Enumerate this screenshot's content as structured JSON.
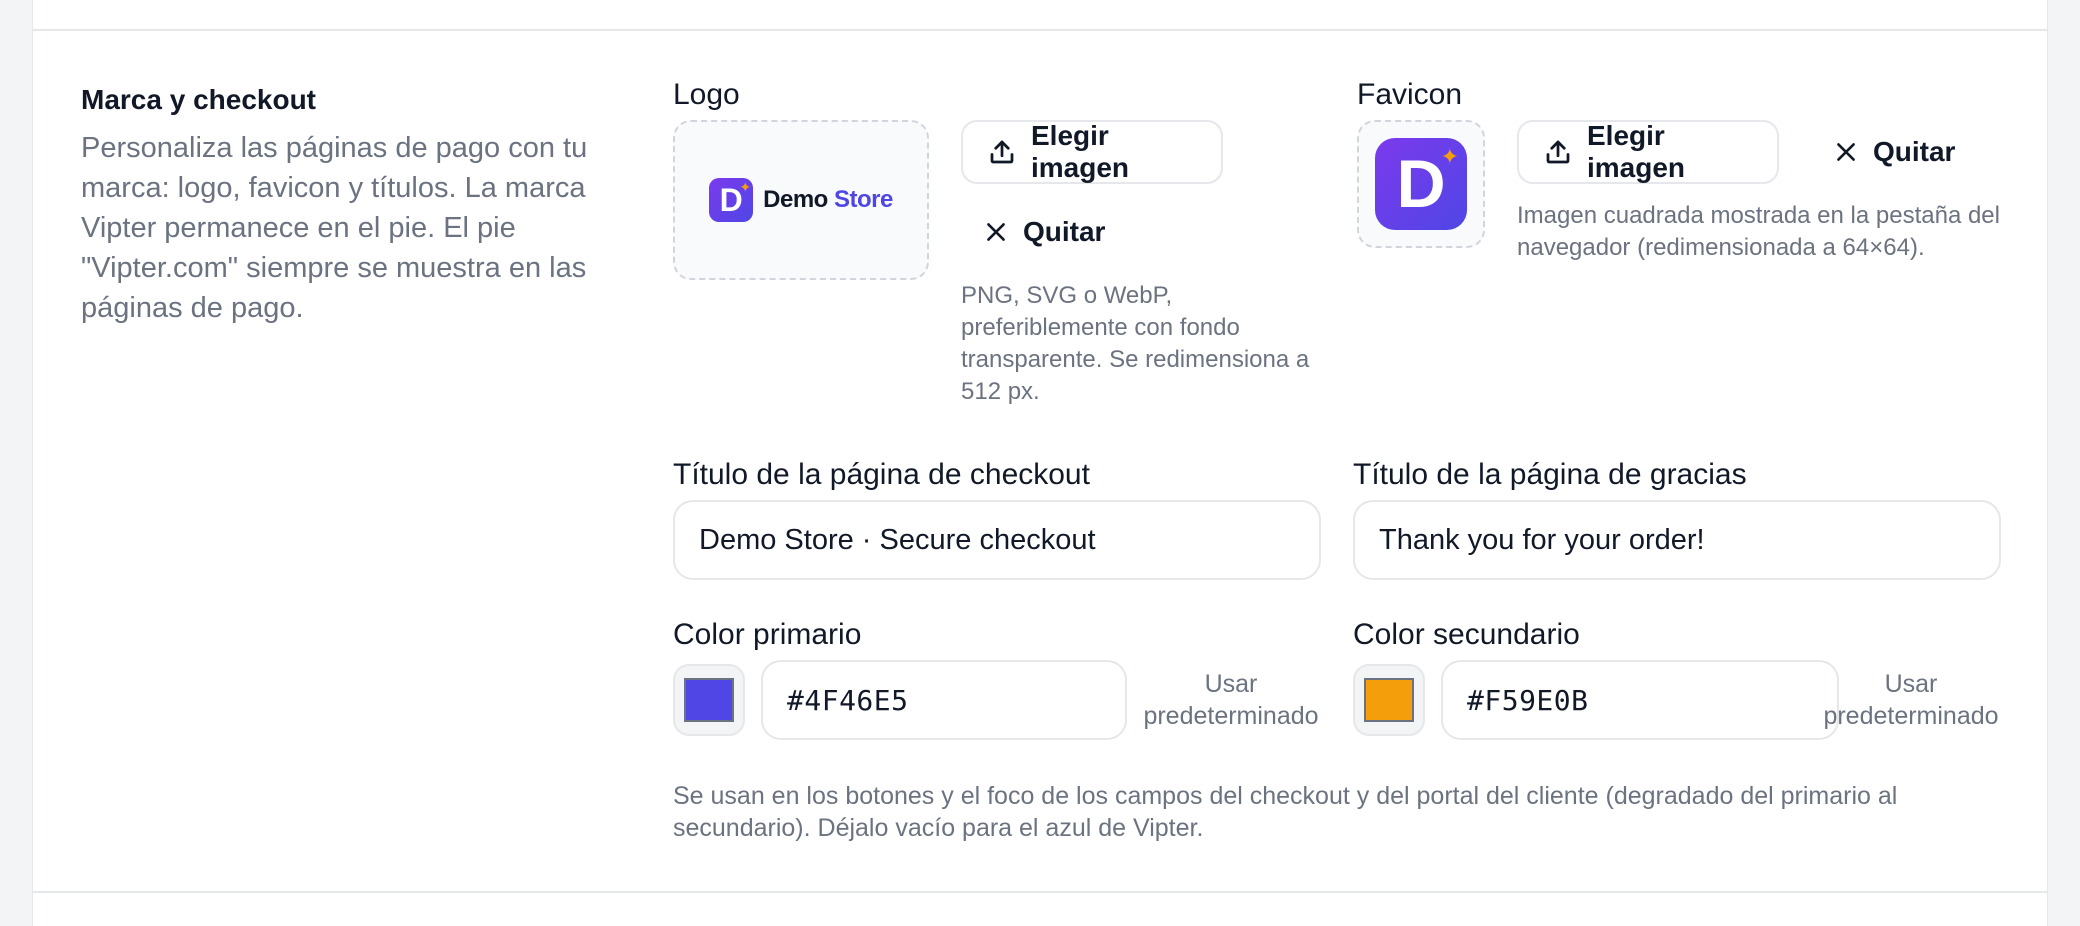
{
  "section": {
    "title": "Marca y checkout",
    "description": "Personaliza las páginas de pago con tu marca: logo, favicon y títulos. La marca Vipter permanece en el pie. El pie \"Vipter.com\" siempre se muestra en las páginas de pago."
  },
  "logo": {
    "label": "Logo",
    "preview_brand": "Demo",
    "preview_brand_accent": "Store",
    "choose_label": "Elegir imagen",
    "remove_label": "Quitar",
    "help": "PNG, SVG o WebP, preferiblemente con fondo transparente. Se redimensiona a 512 px."
  },
  "favicon": {
    "label": "Favicon",
    "choose_label": "Elegir imagen",
    "remove_label": "Quitar",
    "help": "Imagen cuadrada mostrada en la pestaña del navegador (redimensionada a 64×64)."
  },
  "checkout_title": {
    "label": "Título de la página de checkout",
    "value": "Demo Store · Secure checkout"
  },
  "thanks_title": {
    "label": "Título de la página de gracias",
    "value": "Thank you for your order!"
  },
  "primary_color": {
    "label": "Color primario",
    "value": "#4F46E5",
    "use_default": "Usar predeterminado"
  },
  "secondary_color": {
    "label": "Color secundario",
    "value": "#F59E0B",
    "use_default": "Usar predeterminado"
  },
  "colors_help": "Se usan en los botones y el foco de los campos del checkout y del portal del cliente (degradado del primario al secundario). Déjalo vacío para el azul de Vipter.",
  "icons": {
    "upload": "upload-icon",
    "close": "close-icon"
  }
}
